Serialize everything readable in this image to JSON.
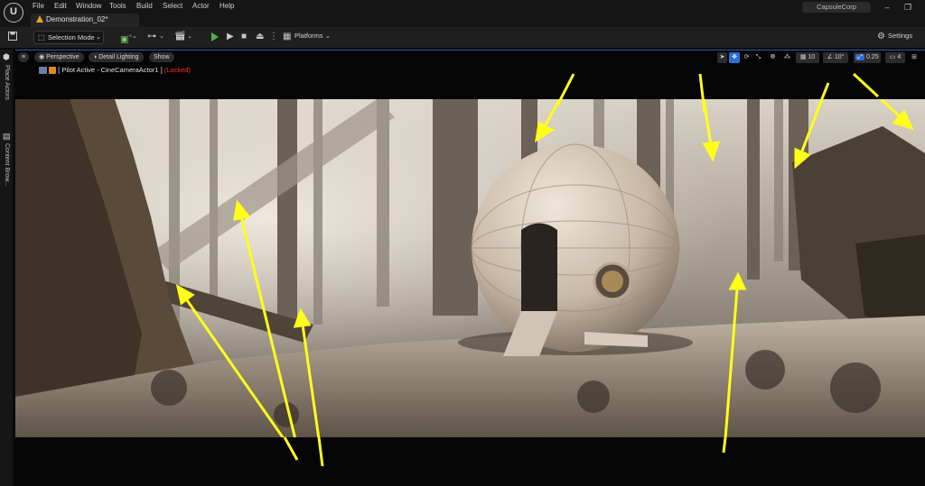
{
  "menu": {
    "items": [
      "File",
      "Edit",
      "Window",
      "Tools",
      "Build",
      "Select",
      "Actor",
      "Help"
    ]
  },
  "tab": {
    "title": "Demonstration_02*"
  },
  "window": {
    "project": "CapsuleCorp",
    "minimize": "–",
    "maximize": "❐"
  },
  "toolbar": {
    "selection_mode": "Selection Mode",
    "platforms": "Platforms",
    "settings": "Settings"
  },
  "sidebar": {
    "place_actors": "Place Actors",
    "content_browser": "Content Brow..."
  },
  "viewport": {
    "perspective": "Perspective",
    "detail_lighting": "Detail Lighting",
    "show": "Show",
    "pilot_text": "[ Pilot Active - CineCameraActor1 ]",
    "locked": "(Locked)",
    "grid_size": "10",
    "rotation_snap": "10°",
    "scale_snap": "0.25",
    "camera_speed": "4"
  },
  "colors": {
    "accent_blue": "#2a5ea8",
    "play_green": "#52b04a",
    "locked_red": "#ff3030",
    "annotation_yellow": "#ffff1a"
  }
}
